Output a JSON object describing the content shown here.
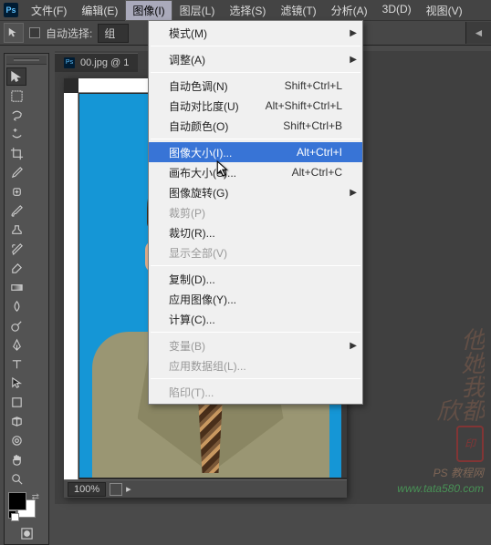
{
  "menubar": {
    "items": [
      {
        "label": "文件(F)"
      },
      {
        "label": "编辑(E)"
      },
      {
        "label": "图像(I)",
        "active": true
      },
      {
        "label": "图层(L)"
      },
      {
        "label": "选择(S)"
      },
      {
        "label": "滤镜(T)"
      },
      {
        "label": "分析(A)"
      },
      {
        "label": "3D(D)"
      },
      {
        "label": "视图(V)"
      }
    ]
  },
  "options": {
    "auto_select_label": "自动选择:",
    "group_label": "组"
  },
  "tab": {
    "filename": "00.jpg @ 1"
  },
  "status": {
    "zoom": "100%"
  },
  "menu": {
    "groups": [
      [
        {
          "label": "模式(M)",
          "submenu": true
        }
      ],
      [
        {
          "label": "调整(A)",
          "submenu": true
        }
      ],
      [
        {
          "label": "自动色调(N)",
          "accel": "Shift+Ctrl+L"
        },
        {
          "label": "自动对比度(U)",
          "accel": "Alt+Shift+Ctrl+L"
        },
        {
          "label": "自动颜色(O)",
          "accel": "Shift+Ctrl+B"
        }
      ],
      [
        {
          "label": "图像大小(I)...",
          "accel": "Alt+Ctrl+I",
          "highlight": true
        },
        {
          "label": "画布大小(S)...",
          "accel": "Alt+Ctrl+C"
        },
        {
          "label": "图像旋转(G)",
          "submenu": true
        },
        {
          "label": "裁剪(P)",
          "disabled": true
        },
        {
          "label": "裁切(R)..."
        },
        {
          "label": "显示全部(V)",
          "disabled": true
        }
      ],
      [
        {
          "label": "复制(D)..."
        },
        {
          "label": "应用图像(Y)..."
        },
        {
          "label": "计算(C)..."
        }
      ],
      [
        {
          "label": "变量(B)",
          "submenu": true,
          "disabled": true
        },
        {
          "label": "应用数据组(L)...",
          "disabled": true
        }
      ],
      [
        {
          "label": "陷印(T)...",
          "disabled": true
        }
      ]
    ]
  },
  "watermark": {
    "chars": "他她我都欣",
    "line1": "PS 教程网",
    "line2": "www.tata580.com"
  }
}
